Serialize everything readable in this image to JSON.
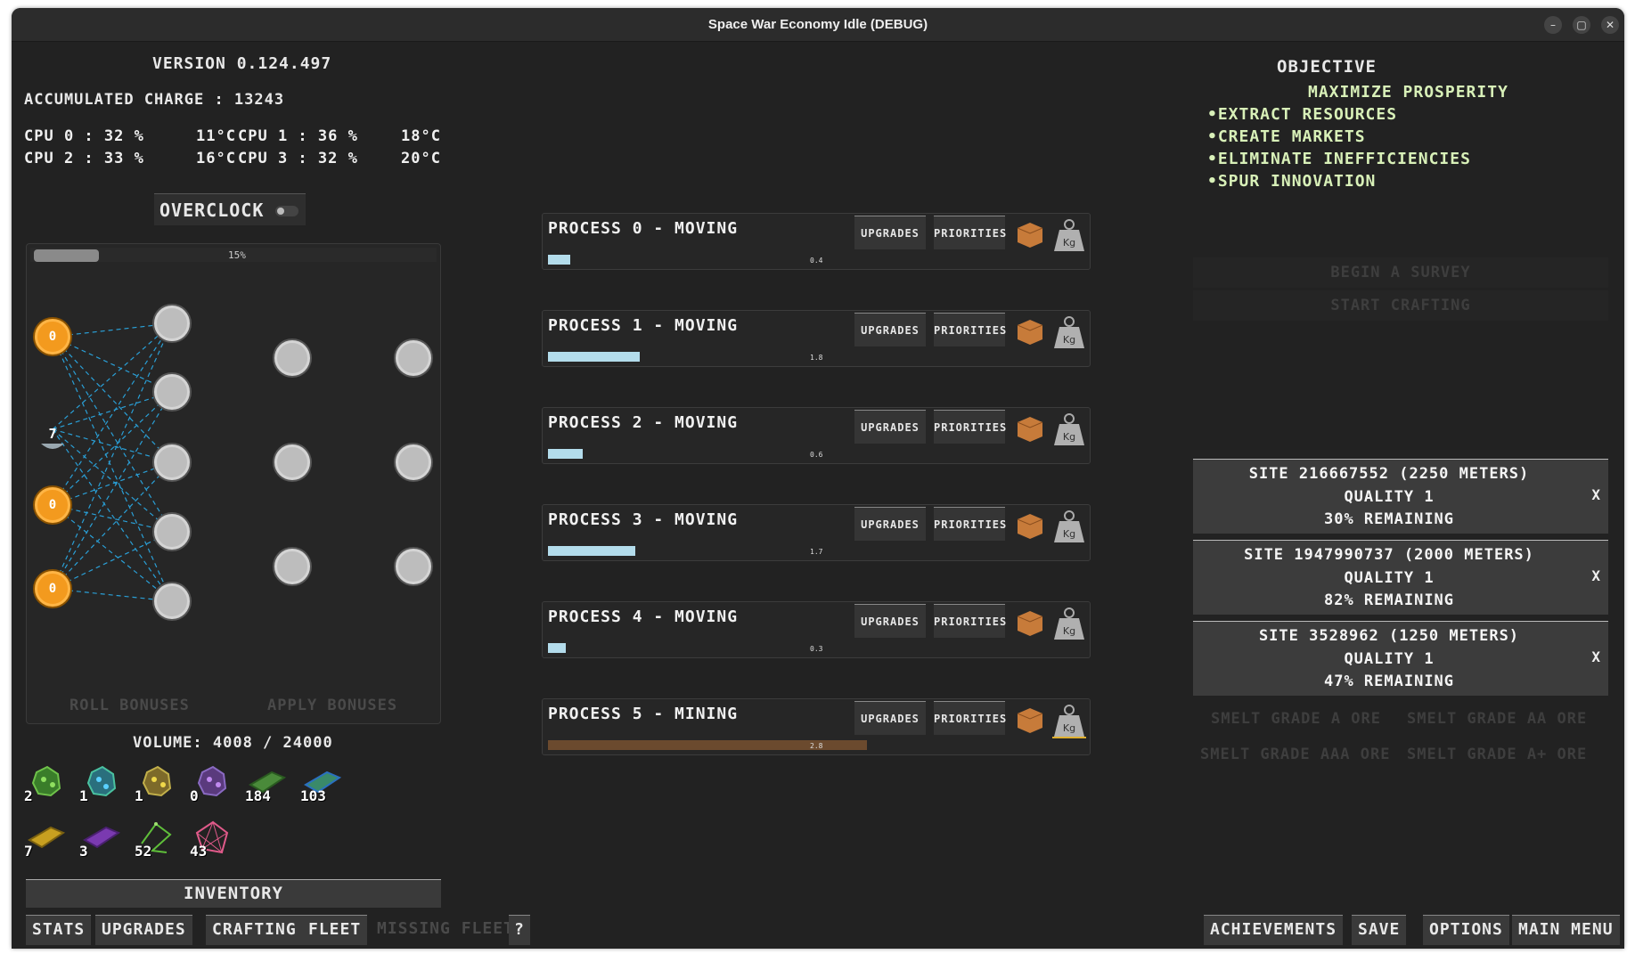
{
  "window": {
    "title": "Space War Economy Idle (DEBUG)",
    "min_glyph": "–",
    "max_glyph": "▢",
    "close_glyph": "✕"
  },
  "left": {
    "version": "VERSION 0.124.497",
    "charge": "ACCUMULATED CHARGE : 13243",
    "cpus": [
      {
        "label": "CPU 0 : 32 %",
        "temp": "11°C"
      },
      {
        "label": "CPU 1 : 36 %",
        "temp": "18°C"
      },
      {
        "label": "CPU 2 : 33 %",
        "temp": "16°C"
      },
      {
        "label": "CPU 3 : 32 %",
        "temp": "20°C"
      }
    ],
    "overclock_label": "OVERCLOCK",
    "overclock_on": false,
    "network": {
      "progress_label": "15%",
      "progress": 0.15,
      "input_nodes": [
        "0",
        "0",
        "0"
      ],
      "bias_label": "7",
      "roll_label": "ROLL BONUSES",
      "apply_label": "APPLY BONUSES"
    },
    "volume": "VOLUME: 4008 / 24000",
    "inventory": [
      {
        "icon": "green-ore-icon",
        "count": "2"
      },
      {
        "icon": "teal-ore-icon",
        "count": "1"
      },
      {
        "icon": "yellow-ore-icon",
        "count": "1"
      },
      {
        "icon": "purple-ore-icon",
        "count": "0"
      },
      {
        "icon": "green-ingot-icon",
        "count": "184"
      },
      {
        "icon": "blue-ingot-icon",
        "count": "103"
      },
      {
        "icon": "gold-ingot-icon",
        "count": "7"
      },
      {
        "icon": "purple-ingot-icon",
        "count": "3"
      },
      {
        "icon": "green-circuit-icon",
        "count": "52"
      },
      {
        "icon": "pink-circuit-icon",
        "count": "43"
      }
    ],
    "inventory_label": "INVENTORY",
    "tabs": [
      "STATS",
      "UPGRADES",
      "CRAFTING",
      "FLEET"
    ],
    "missing_fleet": "MISSING FLEET",
    "help": "?"
  },
  "processes": [
    {
      "title": "PROCESS 0 - MOVING",
      "progress": 0.05,
      "value": "0.4",
      "bar_color": "#b3dceb"
    },
    {
      "title": "PROCESS 1 - MOVING",
      "progress": 0.21,
      "value": "1.8",
      "bar_color": "#b3dceb"
    },
    {
      "title": "PROCESS 2 - MOVING",
      "progress": 0.08,
      "value": "0.6",
      "bar_color": "#b3dceb"
    },
    {
      "title": "PROCESS 3 - MOVING",
      "progress": 0.2,
      "value": "1.7",
      "bar_color": "#b3dceb"
    },
    {
      "title": "PROCESS 4 - MOVING",
      "progress": 0.04,
      "value": "0.3",
      "bar_color": "#b3dceb"
    },
    {
      "title": "PROCESS 5 - MINING",
      "progress": 0.73,
      "value": "2.8",
      "bar_color": "#6b4a2e"
    }
  ],
  "process_buttons": {
    "upgrades": "UPGRADES",
    "priorities": "PRIORITIES",
    "kg": "Kg"
  },
  "right": {
    "objective_title": "OBJECTIVE",
    "objectives": [
      "MAXIMIZE PROSPERITY",
      "•EXTRACT RESOURCES",
      "•CREATE MARKETS",
      "•ELIMINATE INEFFICIENCIES",
      "•SPUR INNOVATION"
    ],
    "begin_survey": "BEGIN A SURVEY",
    "start_crafting": "START CRAFTING",
    "sites": [
      {
        "name": "SITE 216667552 (2250 METERS)",
        "quality": "QUALITY 1",
        "remaining": "30% REMAINING"
      },
      {
        "name": "SITE 1947990737 (2000 METERS)",
        "quality": "QUALITY 1",
        "remaining": "82% REMAINING"
      },
      {
        "name": "SITE 3528962 (1250 METERS)",
        "quality": "QUALITY 1",
        "remaining": "47% REMAINING"
      }
    ],
    "site_close": "X",
    "smelt": [
      "SMELT GRADE A ORE",
      "SMELT GRADE AA ORE",
      "SMELT GRADE AAA ORE",
      "SMELT GRADE A+ ORE"
    ],
    "bottom": [
      "ACHIEVEMENTS",
      "SAVE",
      "OPTIONS",
      "MAIN MENU"
    ]
  },
  "colors": {
    "accent_orange": "#f39a1e",
    "objective_text": "#d8f0b8",
    "link_line": "#2a9fd6"
  }
}
